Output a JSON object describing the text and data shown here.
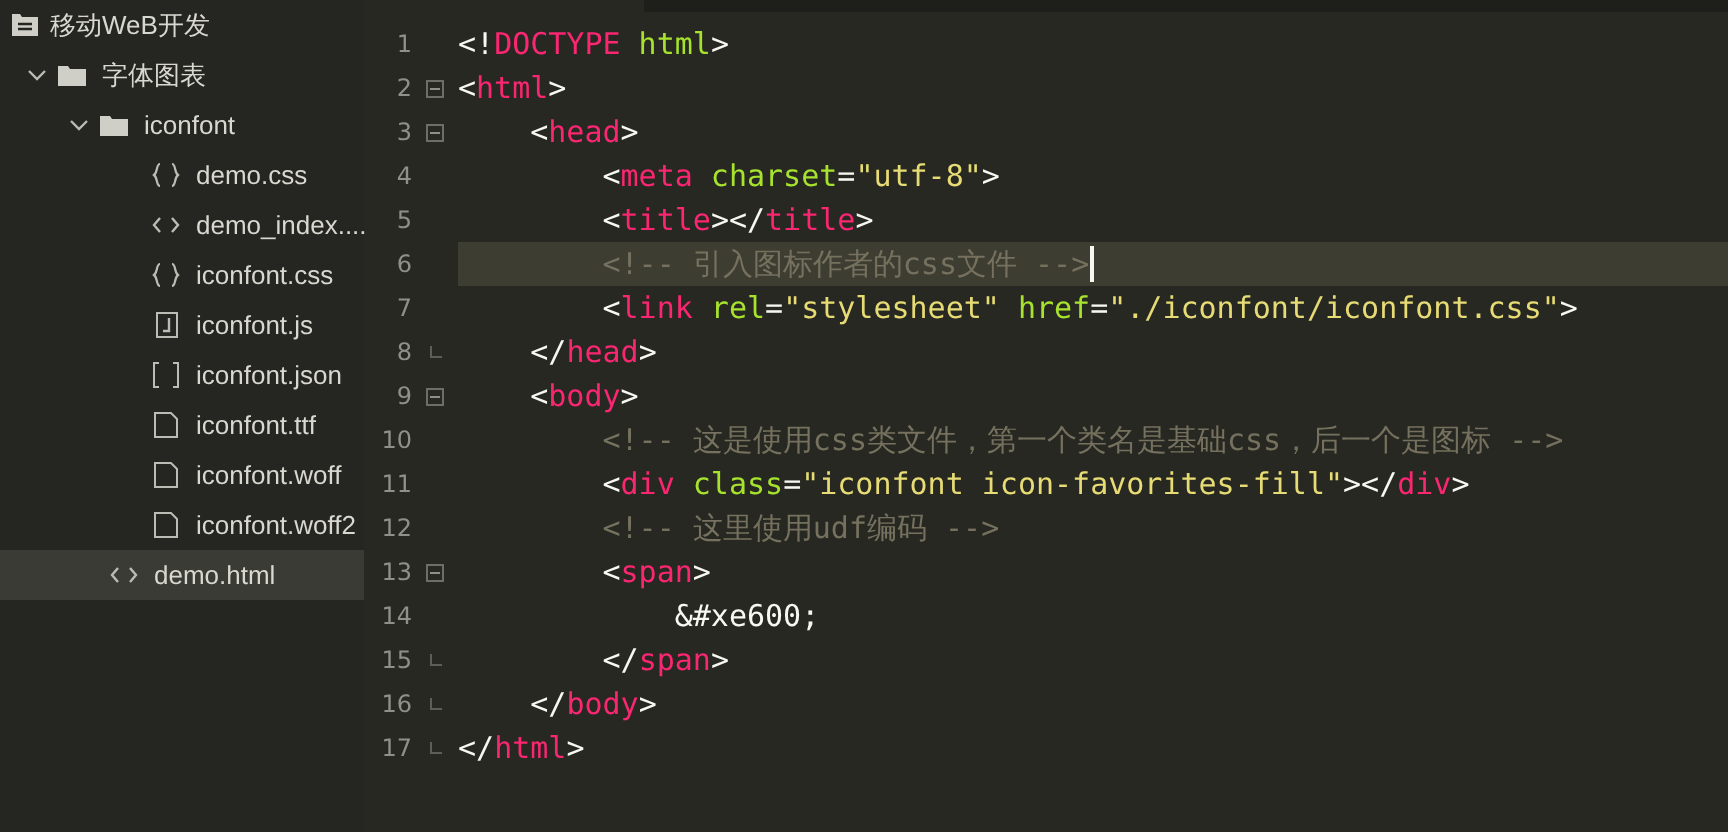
{
  "sidebar": {
    "project": {
      "name": "移动WeB开发",
      "children": [
        {
          "kind": "folder",
          "name": "字体图表",
          "expanded": true,
          "selected": false,
          "children": [
            {
              "kind": "folder",
              "name": "iconfont",
              "expanded": true,
              "selected": false,
              "children": [
                {
                  "kind": "css",
                  "name": "demo.css",
                  "selected": false
                },
                {
                  "kind": "html",
                  "name": "demo_index....",
                  "selected": false
                },
                {
                  "kind": "css",
                  "name": "iconfont.css",
                  "selected": false
                },
                {
                  "kind": "js",
                  "name": "iconfont.js",
                  "selected": false
                },
                {
                  "kind": "json",
                  "name": "iconfont.json",
                  "selected": false
                },
                {
                  "kind": "file",
                  "name": "iconfont.ttf",
                  "selected": false
                },
                {
                  "kind": "file",
                  "name": "iconfont.woff",
                  "selected": false
                },
                {
                  "kind": "file",
                  "name": "iconfont.woff2",
                  "selected": false
                }
              ]
            },
            {
              "kind": "html",
              "name": "demo.html",
              "selected": true
            }
          ]
        }
      ]
    }
  },
  "editor": {
    "lines": [
      {
        "number": "1",
        "collapsible": false,
        "block_end": false,
        "current": false,
        "tokens": [
          {
            "kind": "punct",
            "text": "<!"
          },
          {
            "kind": "tag",
            "text": "DOCTYPE"
          },
          {
            "kind": "attr",
            "text": " html"
          },
          {
            "kind": "punct",
            "text": ">"
          }
        ]
      },
      {
        "number": "2",
        "collapsible": true,
        "block_end": false,
        "current": false,
        "tokens": [
          {
            "kind": "punct",
            "text": "<"
          },
          {
            "kind": "tag",
            "text": "html"
          },
          {
            "kind": "punct",
            "text": ">"
          }
        ]
      },
      {
        "number": "3",
        "collapsible": true,
        "block_end": false,
        "current": false,
        "tokens": [
          {
            "kind": "punct",
            "text": "    <"
          },
          {
            "kind": "tag",
            "text": "head"
          },
          {
            "kind": "punct",
            "text": ">"
          }
        ]
      },
      {
        "number": "4",
        "collapsible": false,
        "block_end": false,
        "current": false,
        "tokens": [
          {
            "kind": "punct",
            "text": "        <"
          },
          {
            "kind": "tag",
            "text": "meta"
          },
          {
            "kind": "attr",
            "text": " charset"
          },
          {
            "kind": "punct",
            "text": "="
          },
          {
            "kind": "string",
            "text": "\"utf-8\""
          },
          {
            "kind": "punct",
            "text": ">"
          }
        ]
      },
      {
        "number": "5",
        "collapsible": false,
        "block_end": false,
        "current": false,
        "tokens": [
          {
            "kind": "punct",
            "text": "        <"
          },
          {
            "kind": "tag",
            "text": "title"
          },
          {
            "kind": "punct",
            "text": "></"
          },
          {
            "kind": "tag",
            "text": "title"
          },
          {
            "kind": "punct",
            "text": ">"
          }
        ]
      },
      {
        "number": "6",
        "collapsible": false,
        "block_end": false,
        "current": true,
        "tokens": [
          {
            "kind": "comment",
            "text": "        <!-- 引入图标作者的css文件 -->"
          }
        ]
      },
      {
        "number": "7",
        "collapsible": false,
        "block_end": false,
        "current": false,
        "tokens": [
          {
            "kind": "punct",
            "text": "        <"
          },
          {
            "kind": "tag",
            "text": "link"
          },
          {
            "kind": "attr",
            "text": " rel"
          },
          {
            "kind": "punct",
            "text": "="
          },
          {
            "kind": "string",
            "text": "\"stylesheet\""
          },
          {
            "kind": "attr",
            "text": " href"
          },
          {
            "kind": "punct",
            "text": "="
          },
          {
            "kind": "string",
            "text": "\"./iconfont/iconfont.css\""
          },
          {
            "kind": "punct",
            "text": ">"
          }
        ]
      },
      {
        "number": "8",
        "collapsible": false,
        "block_end": true,
        "current": false,
        "tokens": [
          {
            "kind": "punct",
            "text": "    </"
          },
          {
            "kind": "tag",
            "text": "head"
          },
          {
            "kind": "punct",
            "text": ">"
          }
        ]
      },
      {
        "number": "9",
        "collapsible": true,
        "block_end": false,
        "current": false,
        "tokens": [
          {
            "kind": "punct",
            "text": "    <"
          },
          {
            "kind": "tag",
            "text": "body"
          },
          {
            "kind": "punct",
            "text": ">"
          }
        ]
      },
      {
        "number": "10",
        "collapsible": false,
        "block_end": false,
        "current": false,
        "tokens": [
          {
            "kind": "comment",
            "text": "        <!-- 这是使用css类文件，第一个类名是基础css，后一个是图标 -->"
          }
        ]
      },
      {
        "number": "11",
        "collapsible": false,
        "block_end": false,
        "current": false,
        "tokens": [
          {
            "kind": "punct",
            "text": "        <"
          },
          {
            "kind": "tag",
            "text": "div"
          },
          {
            "kind": "attr",
            "text": " class"
          },
          {
            "kind": "punct",
            "text": "="
          },
          {
            "kind": "string",
            "text": "\"iconfont icon-favorites-fill\""
          },
          {
            "kind": "punct",
            "text": "></"
          },
          {
            "kind": "tag",
            "text": "div"
          },
          {
            "kind": "punct",
            "text": ">"
          }
        ]
      },
      {
        "number": "12",
        "collapsible": false,
        "block_end": false,
        "current": false,
        "tokens": [
          {
            "kind": "comment",
            "text": "        <!-- 这里使用udf编码 -->"
          }
        ]
      },
      {
        "number": "13",
        "collapsible": true,
        "block_end": false,
        "current": false,
        "tokens": [
          {
            "kind": "punct",
            "text": "        <"
          },
          {
            "kind": "tag",
            "text": "span"
          },
          {
            "kind": "punct",
            "text": ">"
          }
        ]
      },
      {
        "number": "14",
        "collapsible": false,
        "block_end": false,
        "current": false,
        "tokens": [
          {
            "kind": "punct",
            "text": "            &#xe600;"
          }
        ]
      },
      {
        "number": "15",
        "collapsible": false,
        "block_end": true,
        "current": false,
        "tokens": [
          {
            "kind": "punct",
            "text": "        </"
          },
          {
            "kind": "tag",
            "text": "span"
          },
          {
            "kind": "punct",
            "text": ">"
          }
        ]
      },
      {
        "number": "16",
        "collapsible": false,
        "block_end": true,
        "current": false,
        "tokens": [
          {
            "kind": "punct",
            "text": "    </"
          },
          {
            "kind": "tag",
            "text": "body"
          },
          {
            "kind": "punct",
            "text": ">"
          }
        ]
      },
      {
        "number": "17",
        "collapsible": false,
        "block_end": true,
        "current": false,
        "tokens": [
          {
            "kind": "punct",
            "text": "</"
          },
          {
            "kind": "tag",
            "text": "html"
          },
          {
            "kind": "punct",
            "text": ">"
          }
        ]
      }
    ]
  }
}
